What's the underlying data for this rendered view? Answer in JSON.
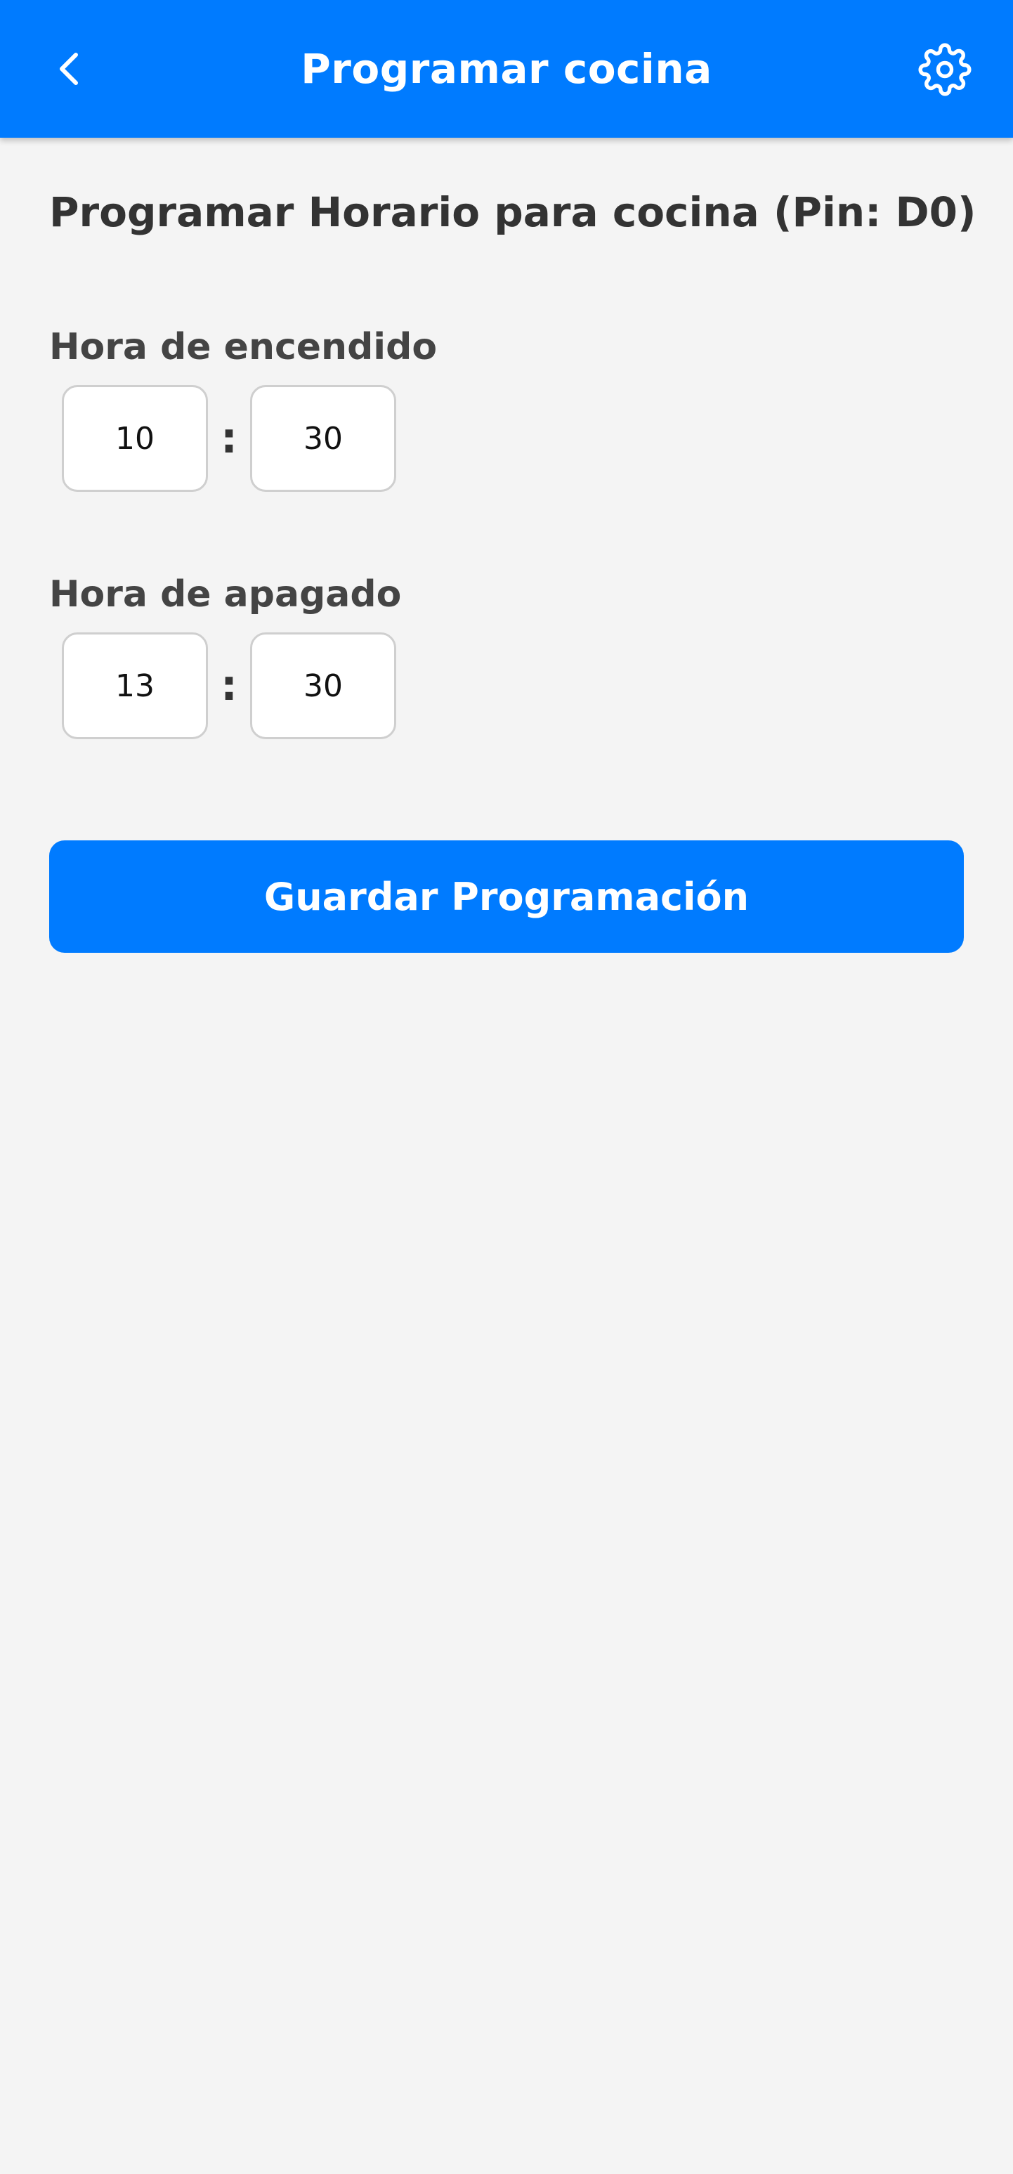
{
  "header": {
    "title": "Programar cocina",
    "back_icon": "chevron-left-icon",
    "settings_icon": "gear-icon",
    "color": "#007bff"
  },
  "main": {
    "title": "Programar Horario para cocina (Pin: D0)",
    "on_time": {
      "label": "Hora de encendido",
      "hour": "10",
      "separator": ":",
      "minute": "30"
    },
    "off_time": {
      "label": "Hora de apagado",
      "hour": "13",
      "separator": ":",
      "minute": "30"
    },
    "save_label": "Guardar Programación"
  },
  "colors": {
    "accent": "#007bff",
    "background": "#f4f4f4",
    "input_border": "#cfcfcf"
  }
}
